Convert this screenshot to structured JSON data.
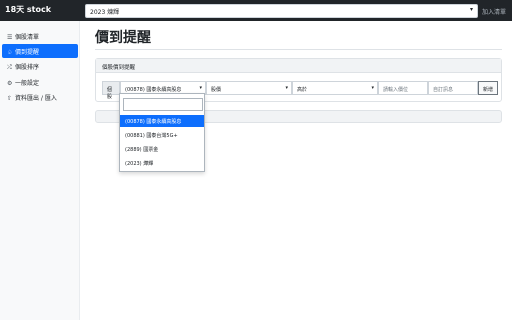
{
  "app": {
    "brand": "18天 stock"
  },
  "topbar": {
    "stock_select": "2023 煉輝",
    "add_watch_label": "加入清單"
  },
  "sidebar": {
    "items": [
      {
        "label": "個股清單",
        "icon": "list-icon"
      },
      {
        "label": "價到提醒",
        "icon": "bell-icon",
        "active": true
      },
      {
        "label": "個股排序",
        "icon": "shuffle-icon"
      },
      {
        "label": "一般設定",
        "icon": "gear-icon"
      },
      {
        "label": "資料匯出 / 匯入",
        "icon": "export-icon"
      }
    ]
  },
  "main": {
    "title": "價到提醒",
    "card_header": "個股價到提醒",
    "form": {
      "prefix": "個股",
      "stock_value": "(00878) 國泰永續高股息",
      "price_type": "股價",
      "compare": "高於",
      "price_placeholder": "請輸入價位",
      "note_placeholder": "自訂訊息",
      "add_button": "新增"
    }
  },
  "dropdown": {
    "options": [
      {
        "label": "(00878) 國泰永續高股息",
        "selected": true
      },
      {
        "label": "(00881) 國泰台灣5G+"
      },
      {
        "label": "(2889) 國票金"
      },
      {
        "label": "(2023) 燁輝"
      }
    ]
  },
  "colors": {
    "accent": "#0d6efd",
    "topbar": "#212529"
  }
}
